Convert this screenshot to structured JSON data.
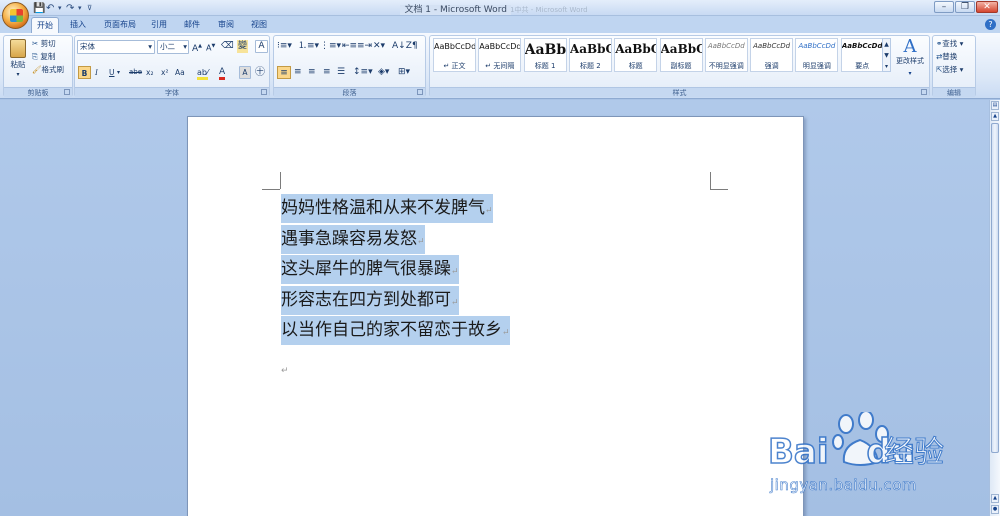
{
  "window": {
    "title": "文档 1 - Microsoft Word",
    "ghost_title": "整改单1中共 - Microsoft Word"
  },
  "qat": {
    "save": "💾",
    "undo": "↶",
    "redo": "↷",
    "more": "▾"
  },
  "tabs": [
    "开始",
    "插入",
    "页面布局",
    "引用",
    "邮件",
    "审阅",
    "视图"
  ],
  "clipboard": {
    "paste": "粘贴",
    "cut": "剪切",
    "copy": "复制",
    "format_painter": "格式刷",
    "label": "剪贴板"
  },
  "font": {
    "family": "宋体",
    "size": "小二",
    "label": "字体",
    "buttons": [
      "B",
      "I",
      "U",
      "abe",
      "x₂",
      "x²",
      "Aa"
    ]
  },
  "paragraph": {
    "label": "段落"
  },
  "styles": {
    "label": "样式",
    "tiles": [
      {
        "preview": "AaBbCcDd",
        "name": "↵ 正文"
      },
      {
        "preview": "AaBbCcDd",
        "name": "↵ 无间隔"
      },
      {
        "preview": "AaBb",
        "name": "标题 1"
      },
      {
        "preview": "AaBbC",
        "name": "标题 2"
      },
      {
        "preview": "AaBbC",
        "name": "标题"
      },
      {
        "preview": "AaBbC",
        "name": "副标题"
      },
      {
        "preview": "AaBbCcDd",
        "name": "不明显强调"
      },
      {
        "preview": "AaBbCcDd",
        "name": "强调"
      },
      {
        "preview": "AaBbCcDd",
        "name": "明显强调"
      },
      {
        "preview": "AaBbCcDd",
        "name": "要点"
      }
    ],
    "change_styles": "更改样式"
  },
  "editing": {
    "find": "查找",
    "replace": "替换",
    "select": "选择",
    "label": "编辑"
  },
  "document": {
    "lines": [
      "妈妈性格温和从来不发脾气",
      "遇事急躁容易发怒",
      "这头犀牛的脾气很暴躁",
      "形容志在四方到处都可",
      "以当作自己的家不留恋于故乡"
    ],
    "para_mark": "↵"
  },
  "watermark": {
    "brand": "Bai",
    "brand2": "du",
    "cn": "经验",
    "url": "jingyan.baidu.com"
  },
  "colors": {
    "selection": "#b4d0ee",
    "ribbon_text": "#15428b",
    "baidu_blue": "#2f6fc6",
    "baidu_red": "#d9281e"
  }
}
